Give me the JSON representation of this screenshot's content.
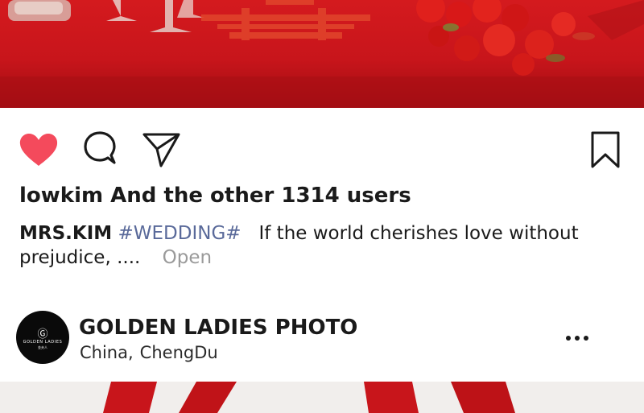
{
  "post": {
    "actions": {
      "like_icon": "heart-filled-icon",
      "comment_icon": "comment-icon",
      "share_icon": "send-icon",
      "save_icon": "bookmark-icon",
      "like_color": "#f44a5c"
    },
    "likes_text": "lowkim And the other 1314 users",
    "caption": {
      "username": "MRS.KIM",
      "hashtag": "#WEDDING#",
      "text": "If the world cherishes love without prejudice, ....",
      "open_label": "Open"
    }
  },
  "author": {
    "name": "GOLDEN LADIES PHOTO",
    "location_country": "China,",
    "location_city": "ChengDu",
    "avatar_logo_text": "GOLDEN LADIES",
    "avatar_logo_sub": "金夫人",
    "more_icon": "more-horizontal-icon"
  },
  "colors": {
    "accent_red": "#c8151b",
    "hashtag": "#5a6a9a",
    "muted": "#9a9a9a"
  }
}
